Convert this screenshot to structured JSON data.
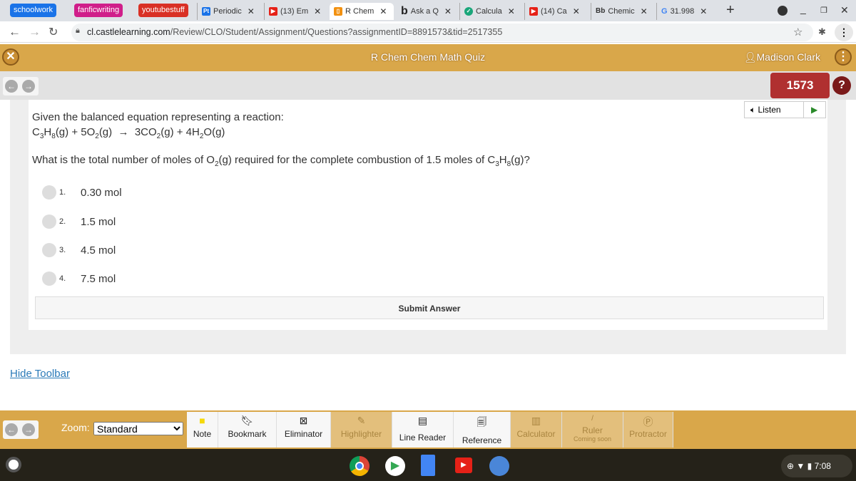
{
  "browser": {
    "bookmarks": [
      {
        "label": "schoolwork",
        "color": "#1a73e8"
      },
      {
        "label": "fanficwriting",
        "color": "#d01e8a"
      },
      {
        "label": "youtubestuff",
        "color": "#d93025"
      }
    ],
    "tabs": [
      {
        "label": "Periodic",
        "icon": "Pt"
      },
      {
        "label": "(13) Em",
        "icon": "youtube"
      },
      {
        "label": "R Chem",
        "icon": "castle"
      },
      {
        "label": "Ask a Q",
        "icon": "b"
      },
      {
        "label": "Calcula",
        "icon": "shield"
      },
      {
        "label": "(14) Ca",
        "icon": "youtube"
      },
      {
        "label": "Chemic",
        "icon": "Bb"
      },
      {
        "label": "31.998",
        "icon": "G"
      }
    ],
    "url_domain": "cl.castlelearning.com",
    "url_path": "/Review/CLO/Student/Assignment/Questions?assignmentID=8891573&tid=2517355"
  },
  "header": {
    "title": "R Chem Chem Math Quiz",
    "user": "Madison Clark"
  },
  "score": "1573",
  "help": "?",
  "listen": "Listen",
  "question": {
    "intro": "Given the balanced equation representing a reaction:",
    "prompt": "What is the total number of moles of O2(g) required for the complete combustion of 1.5 moles of C3H8(g)?",
    "options": [
      {
        "num": "1.",
        "text": "0.30 mol"
      },
      {
        "num": "2.",
        "text": "1.5 mol"
      },
      {
        "num": "3.",
        "text": "4.5 mol"
      },
      {
        "num": "4.",
        "text": "7.5 mol"
      }
    ]
  },
  "submit": "Submit Answer",
  "hide_toolbar": "Hide Toolbar",
  "toolbar": {
    "zoom_label": "Zoom:",
    "zoom_value": "Standard",
    "tools": [
      {
        "label": "Note"
      },
      {
        "label": "Bookmark"
      },
      {
        "label": "Eliminator"
      },
      {
        "label": "Highlighter"
      },
      {
        "label": "Line Reader"
      },
      {
        "label": "Reference"
      },
      {
        "label": "Calculator"
      },
      {
        "label": "Ruler",
        "sub": "Coming soon"
      },
      {
        "label": "Protractor"
      }
    ]
  },
  "shelf": {
    "time": "7:08"
  },
  "colors": {
    "header": "#d9a74a",
    "score": "#b03030",
    "link": "#2a7ab8"
  }
}
